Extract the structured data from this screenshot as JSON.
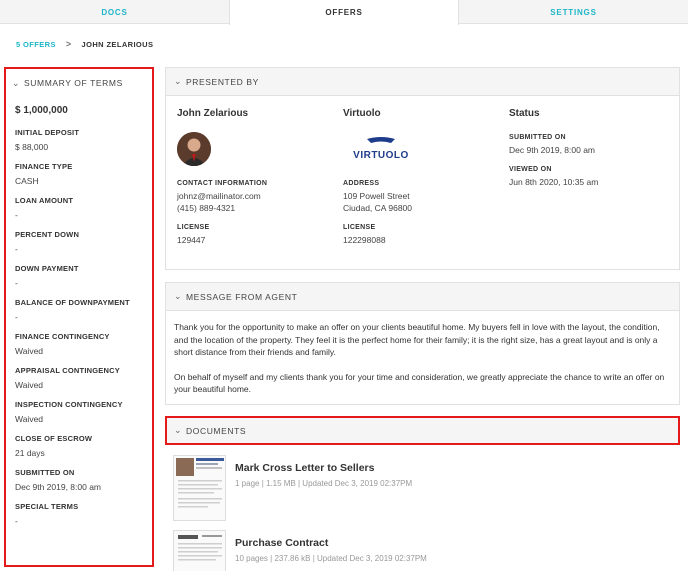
{
  "tabs": [
    {
      "label": "DOCS",
      "active": false
    },
    {
      "label": "OFFERS",
      "active": true
    },
    {
      "label": "SETTINGS",
      "active": false
    }
  ],
  "breadcrumb": {
    "parent": "5 OFFERS",
    "separator": ">",
    "current": "JOHN ZELARIOUS"
  },
  "summary": {
    "title": "SUMMARY OF TERMS",
    "price": "$ 1,000,000",
    "terms": [
      {
        "label": "INITIAL DEPOSIT",
        "value": "$ 88,000"
      },
      {
        "label": "FINANCE TYPE",
        "value": "CASH"
      },
      {
        "label": "LOAN AMOUNT",
        "value": "-"
      },
      {
        "label": "PERCENT DOWN",
        "value": "-"
      },
      {
        "label": "DOWN PAYMENT",
        "value": "-"
      },
      {
        "label": "BALANCE OF DOWNPAYMENT",
        "value": "-"
      },
      {
        "label": "FINANCE CONTINGENCY",
        "value": "Waived"
      },
      {
        "label": "APPRAISAL CONTINGENCY",
        "value": "Waived"
      },
      {
        "label": "INSPECTION CONTINGENCY",
        "value": "Waived"
      },
      {
        "label": "CLOSE OF ESCROW",
        "value": "21 days"
      },
      {
        "label": "SUBMITTED ON",
        "value": "Dec 9th 2019, 8:00 am"
      },
      {
        "label": "SPECIAL TERMS",
        "value": "-"
      }
    ]
  },
  "presented": {
    "title": "PRESENTED BY",
    "agent": {
      "name": "John Zelarious",
      "contact_label": "CONTACT INFORMATION",
      "email": "johnz@mailinator.com",
      "phone": "(415) 889-4321",
      "license_label": "LICENSE",
      "license": "129447"
    },
    "brokerage": {
      "name": "Virtuolo",
      "logo_text": "VIRTUOLO",
      "address_label": "ADDRESS",
      "address_line1": "109 Powell Street",
      "address_line2": "Ciudad, CA 96800",
      "license_label": "LICENSE",
      "license": "122298088"
    },
    "status": {
      "title": "Status",
      "submitted_label": "SUBMITTED ON",
      "submitted": "Dec 9th 2019, 8:00 am",
      "viewed_label": "VIEWED ON",
      "viewed": "Jun 8th 2020, 10:35 am"
    }
  },
  "message": {
    "title": "MESSAGE FROM AGENT",
    "p1": "Thank you for the opportunity to make an offer on your clients beautiful home. My buyers fell in love with the layout, the condition, and the location of the property. They feel it is the perfect home for their family; it is the right size, has a great layout and is only a short distance from their friends and family.",
    "p2": "On behalf of myself and my clients thank you for your time and consideration, we greatly appreciate the chance to write an offer on your beautiful home."
  },
  "documents": {
    "title": "DOCUMENTS",
    "items": [
      {
        "title": "Mark Cross Letter to Sellers",
        "meta": "1 page | 1.15 MB | Updated Dec 3, 2019 02:37PM"
      },
      {
        "title": "Purchase Contract",
        "meta": "10 pages | 237.86 kB | Updated Dec 3, 2019 02:37PM"
      }
    ]
  },
  "colors": {
    "accent": "#1fb5c9",
    "highlight": "#e41a1a",
    "logo_blue": "#1e3c8c"
  }
}
